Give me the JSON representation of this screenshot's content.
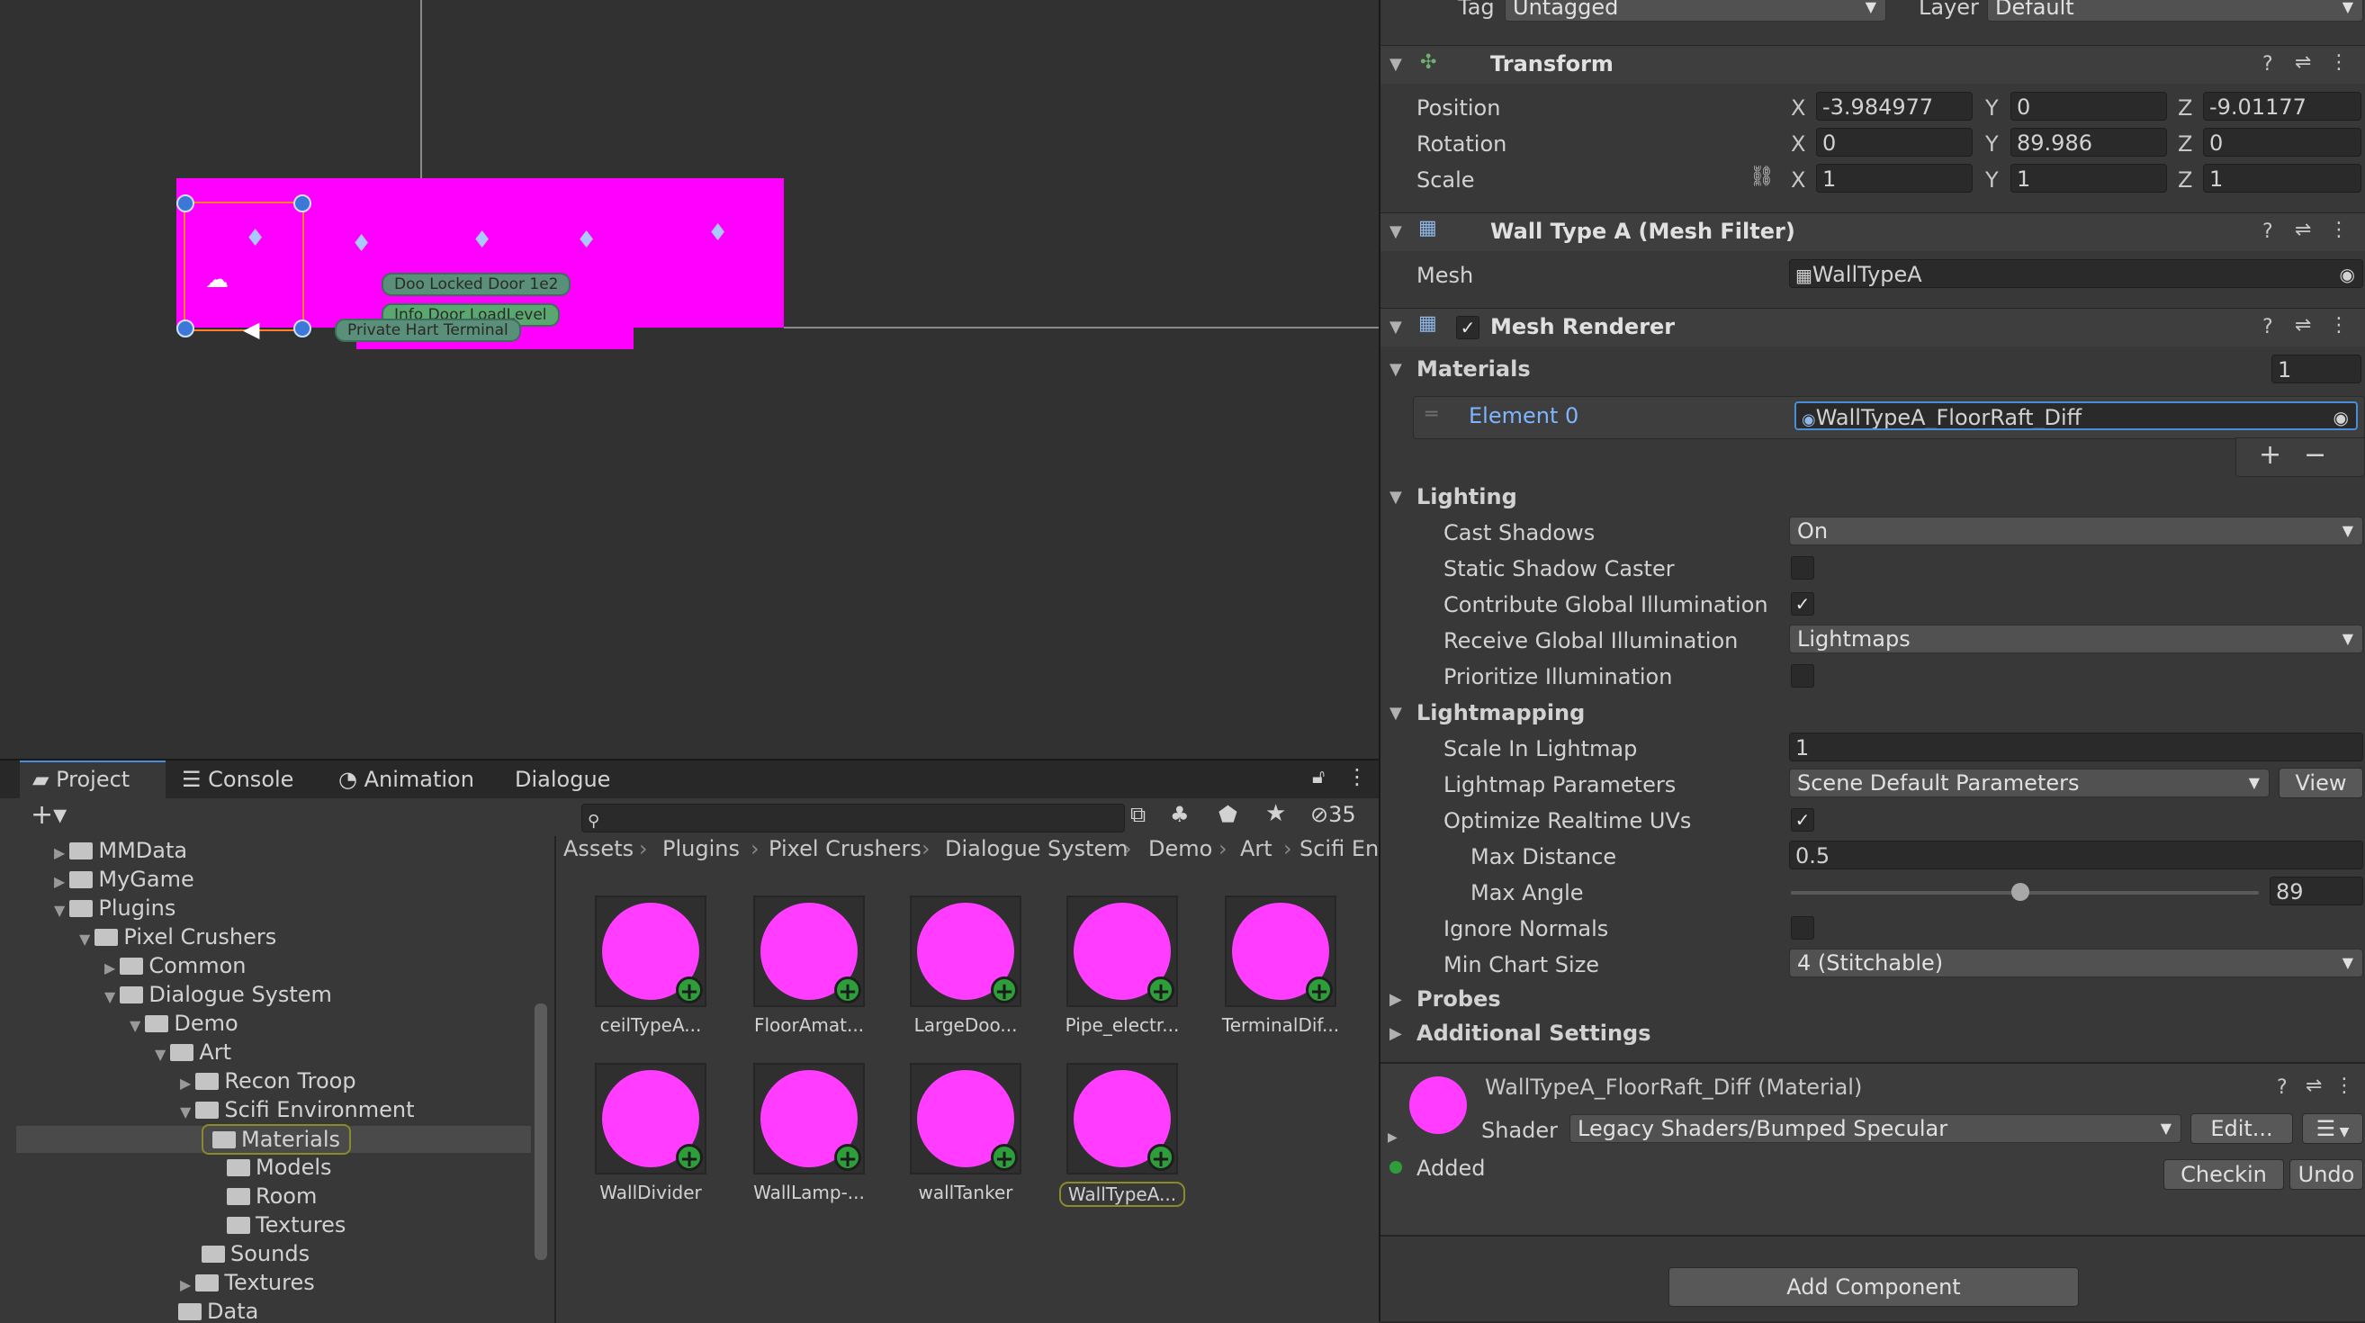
{
  "scene": {
    "labels": [
      "Doo Locked Door 1e2",
      "Info Door LoadLevel",
      "Private Hart Terminal"
    ]
  },
  "inspector": {
    "tag_label": "Tag",
    "tag_value": "Untagged",
    "layer_label": "Layer",
    "layer_value": "Default",
    "transform": {
      "title": "Transform",
      "position_label": "Position",
      "rotation_label": "Rotation",
      "scale_label": "Scale",
      "axes": {
        "x": "X",
        "y": "Y",
        "z": "Z"
      },
      "position": {
        "x": "-3.984977",
        "y": "0",
        "z": "-9.01177"
      },
      "rotation": {
        "x": "0",
        "y": "89.986",
        "z": "0"
      },
      "scale": {
        "x": "1",
        "y": "1",
        "z": "1"
      }
    },
    "mesh_filter": {
      "title": "Wall Type A (Mesh Filter)",
      "mesh_label": "Mesh",
      "mesh_value": "WallTypeA"
    },
    "mesh_renderer": {
      "title": "Mesh Renderer",
      "materials_label": "Materials",
      "materials_count": "1",
      "element_label": "Element 0",
      "element_value": "WallTypeA_FloorRaft_Diff",
      "add": "+",
      "remove": "−",
      "lighting_label": "Lighting",
      "cast_shadows_label": "Cast Shadows",
      "cast_shadows_value": "On",
      "static_shadow_label": "Static Shadow Caster",
      "contribute_gi_label": "Contribute Global Illumination",
      "receive_gi_label": "Receive Global Illumination",
      "receive_gi_value": "Lightmaps",
      "prioritize_label": "Prioritize Illumination",
      "lightmapping_label": "Lightmapping",
      "scale_lightmap_label": "Scale In Lightmap",
      "scale_lightmap_value": "1",
      "lightmap_params_label": "Lightmap Parameters",
      "lightmap_params_value": "Scene Default Parameters",
      "view_label": "View",
      "optimize_uvs_label": "Optimize Realtime UVs",
      "max_distance_label": "Max Distance",
      "max_distance_value": "0.5",
      "max_angle_label": "Max Angle",
      "max_angle_value": "89",
      "max_angle_fraction": 0.49,
      "ignore_normals_label": "Ignore Normals",
      "min_chart_label": "Min Chart Size",
      "min_chart_value": "4 (Stitchable)",
      "probes_label": "Probes",
      "additional_label": "Additional Settings"
    },
    "material": {
      "name": "WallTypeA_FloorRaft_Diff",
      "suffix": "(Material)",
      "shader_label": "Shader",
      "shader_value": "Legacy Shaders/Bumped Specular",
      "edit_label": "Edit...",
      "added_label": "Added",
      "checkin_label": "Checkin",
      "undo_label": "Undo"
    },
    "add_component": "Add Component"
  },
  "project": {
    "tabs": [
      "Project",
      "Console",
      "Animation",
      "Dialogue"
    ],
    "search_placeholder": "",
    "hidden_count": "35",
    "breadcrumb": [
      "Assets",
      "Plugins",
      "Pixel Crushers",
      "Dialogue System",
      "Demo",
      "Art",
      "Scifi En"
    ],
    "tree": [
      "MMData",
      "MyGame",
      "Plugins",
      "Pixel Crushers",
      "Common",
      "Dialogue System",
      "Demo",
      "Art",
      "Recon Troop",
      "Scifi Environment",
      "Materials",
      "Models",
      "Room",
      "Textures",
      "Sounds",
      "Textures",
      "Data"
    ],
    "assets": [
      "ceilTypeA...",
      "FloorAmat...",
      "LargeDoo...",
      "Pipe_electr...",
      "TerminalDif...",
      "WallDivider",
      "WallLamp-...",
      "wallTanker",
      "WallTypeA..."
    ]
  },
  "colors": {
    "material_magenta": "#ff3cff",
    "accent_blue": "#7fb4ff",
    "selection": "#2c5d87"
  }
}
